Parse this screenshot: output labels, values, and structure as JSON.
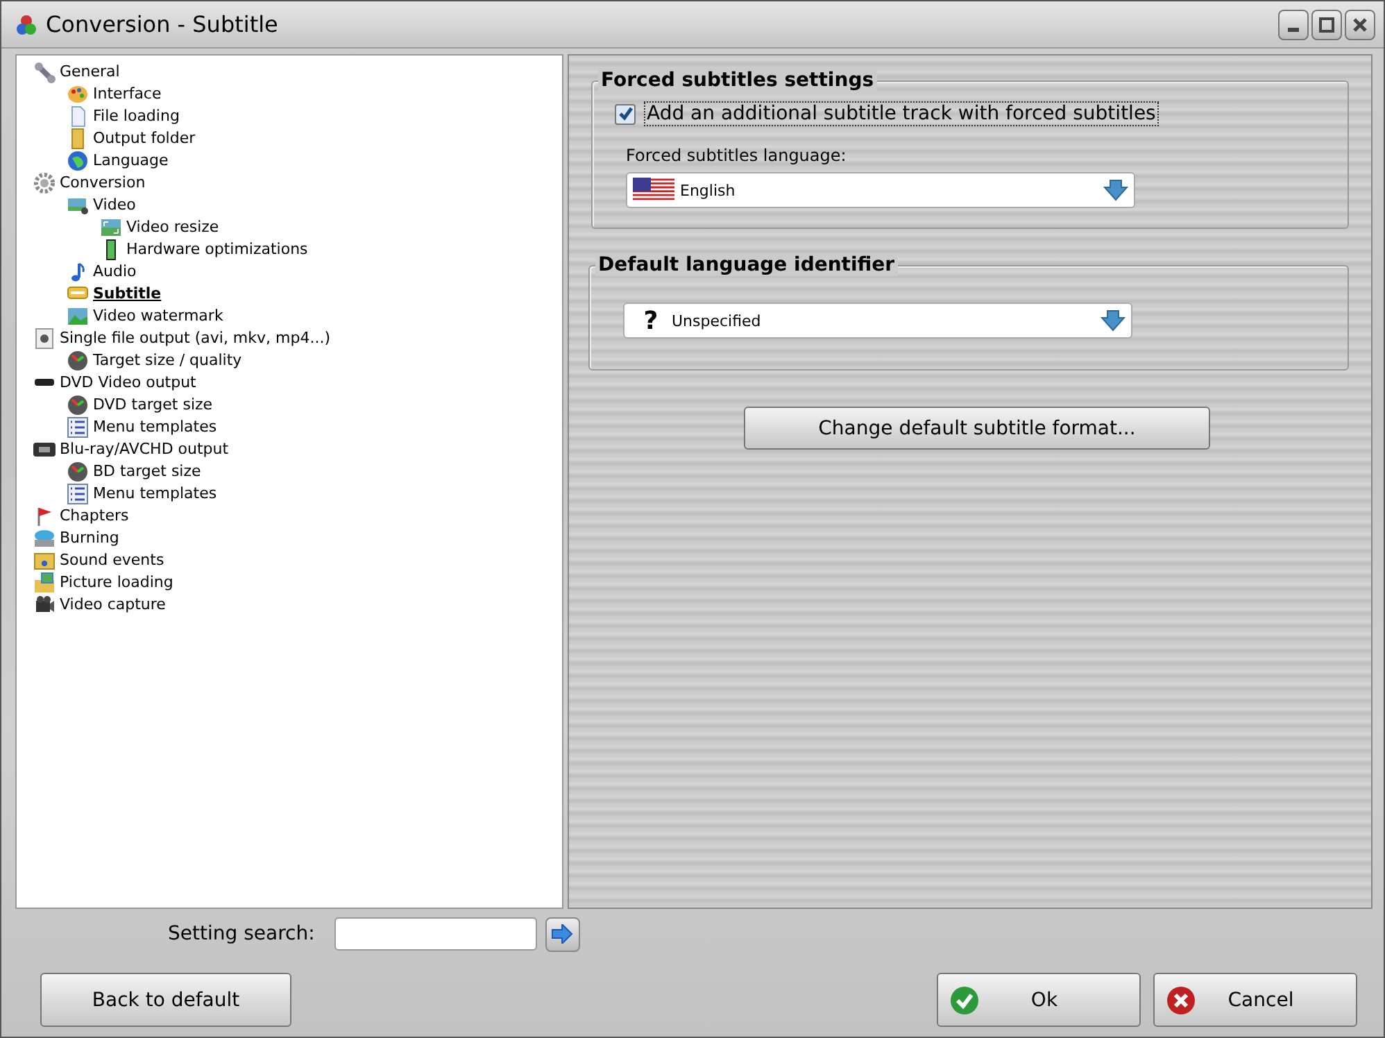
{
  "window": {
    "title": "Conversion - Subtitle"
  },
  "tree": [
    {
      "label": "General",
      "selected": false,
      "children": [
        {
          "label": "Interface",
          "selected": false
        },
        {
          "label": "File loading",
          "selected": false
        },
        {
          "label": "Output folder",
          "selected": false
        },
        {
          "label": "Language",
          "selected": false
        }
      ]
    },
    {
      "label": "Conversion",
      "selected": false,
      "children": [
        {
          "label": "Video",
          "selected": false,
          "children": [
            {
              "label": "Video resize",
              "selected": false
            },
            {
              "label": "Hardware optimizations",
              "selected": false
            }
          ]
        },
        {
          "label": "Audio",
          "selected": false
        },
        {
          "label": "Subtitle",
          "selected": true
        },
        {
          "label": "Video watermark",
          "selected": false
        }
      ]
    },
    {
      "label": "Single file output (avi, mkv, mp4...)",
      "selected": false,
      "children": [
        {
          "label": "Target size / quality",
          "selected": false
        }
      ]
    },
    {
      "label": "DVD Video output",
      "selected": false,
      "children": [
        {
          "label": "DVD target size",
          "selected": false
        },
        {
          "label": "Menu templates",
          "selected": false
        }
      ]
    },
    {
      "label": "Blu-ray/AVCHD output",
      "selected": false,
      "children": [
        {
          "label": "BD target size",
          "selected": false
        },
        {
          "label": "Menu templates",
          "selected": false
        }
      ]
    },
    {
      "label": "Chapters",
      "selected": false
    },
    {
      "label": "Burning",
      "selected": false
    },
    {
      "label": "Sound events",
      "selected": false
    },
    {
      "label": "Picture loading",
      "selected": false
    },
    {
      "label": "Video capture",
      "selected": false
    }
  ],
  "forced_group": {
    "title": "Forced subtitles settings",
    "checkbox": {
      "label": "Add an additional subtitle track with forced subtitles",
      "checked": true
    },
    "language_label": "Forced subtitles language:",
    "language_value": "English"
  },
  "default_group": {
    "title": "Default language identifier",
    "value_icon": "?",
    "value": "Unspecified"
  },
  "format_button": "Change default subtitle format...",
  "search": {
    "label": "Setting search:"
  },
  "buttons": {
    "back": "Back to default",
    "ok": "Ok",
    "cancel": "Cancel"
  }
}
